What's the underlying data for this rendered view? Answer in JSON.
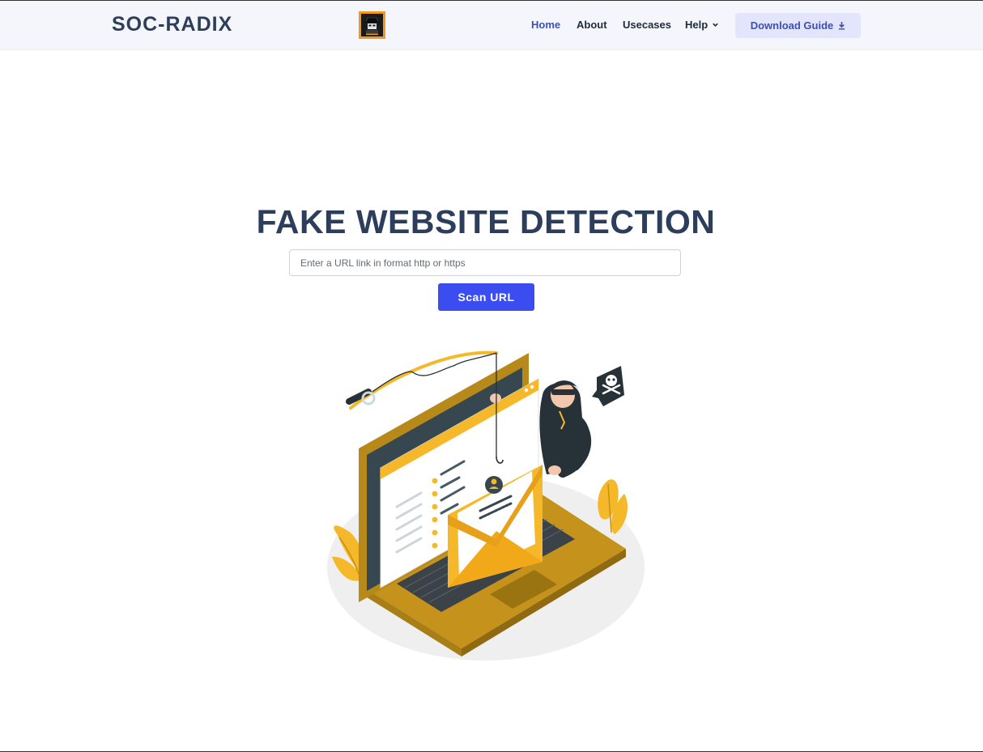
{
  "navbar": {
    "brand": "SOC-RADIX",
    "logo_icon": "detective-logo-icon",
    "links": [
      {
        "label": "Home",
        "active": true
      },
      {
        "label": "About",
        "active": false
      },
      {
        "label": "Usecases",
        "active": false
      },
      {
        "label": "Help",
        "active": false,
        "icon": "chevron-down-icon"
      }
    ],
    "download_button": {
      "label": "Download Guide",
      "icon": "download-icon"
    }
  },
  "hero": {
    "title": "FAKE WEBSITE DETECTION",
    "url_input": {
      "placeholder": "Enter a URL link in format http or https",
      "value": ""
    },
    "scan_button": "Scan URL"
  },
  "illustration": {
    "icon": "phishing-laptop-illustration"
  },
  "colors": {
    "brand_text": "#2c3e5c",
    "accent_blue": "#3b4cf0",
    "nav_active": "#3d4fb8",
    "illustration_gold": "#f5b82a",
    "illustration_dark": "#263238"
  }
}
